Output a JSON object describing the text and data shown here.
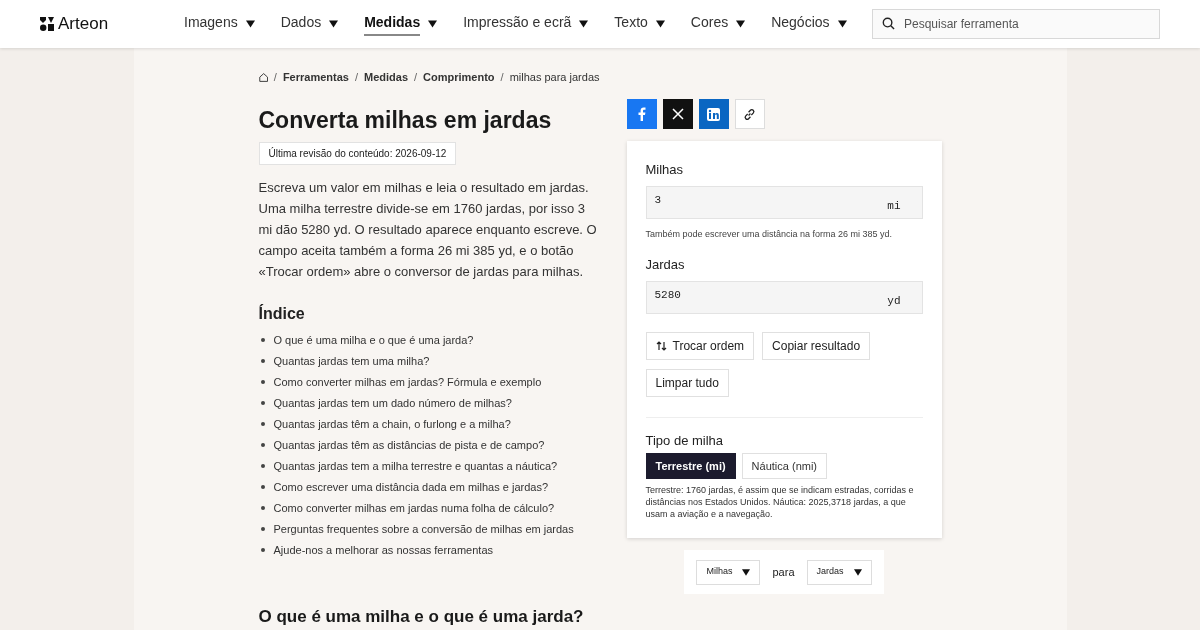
{
  "header": {
    "logo": "Arteon",
    "nav": [
      {
        "label": "Imagens",
        "selected": false
      },
      {
        "label": "Dados",
        "selected": false
      },
      {
        "label": "Medidas",
        "selected": true
      },
      {
        "label": "Impressão e ecrã",
        "selected": false
      },
      {
        "label": "Texto",
        "selected": false
      },
      {
        "label": "Cores",
        "selected": false
      },
      {
        "label": "Negócios",
        "selected": false
      }
    ],
    "search": {
      "placeholder": "Pesquisar ferramenta"
    }
  },
  "breadcrumb": [
    {
      "separator": "/",
      "label": "Ferramentas"
    },
    {
      "separator": "/",
      "label": "Medidas"
    },
    {
      "separator": "/",
      "label": "Comprimento"
    },
    {
      "separator": "/",
      "label": "milhas para jardas"
    }
  ],
  "title": "Converta milhas em jardas",
  "revision": "Última revisão do conteúdo: 2026-09-12",
  "intro": "Escreva um valor em milhas e leia o resultado em jardas. Uma milha terrestre divide-se em 1760 jardas, por isso 3 mi dão 5280 yd. O resultado aparece enquanto escreve. O campo aceita também a forma 26 mi 385 yd, e o botão «Trocar ordem» abre o conversor de jardas para milhas.",
  "toc": {
    "title": "Índice",
    "items": [
      "O que é uma milha e o que é uma jarda?",
      "Quantas jardas tem uma milha?",
      "Como converter milhas em jardas? Fórmula e exemplo",
      "Quantas jardas tem um dado número de milhas?",
      "Quantas jardas têm a chain, o furlong e a milha?",
      "Quantas jardas têm as distâncias de pista e de campo?",
      "Quantas jardas tem a milha terrestre e quantas a náutica?",
      "Como escrever uma distância dada em milhas e jardas?",
      "Como converter milhas em jardas numa folha de cálculo?",
      "Perguntas frequentes sobre a conversão de milhas em jardas",
      "Ajude-nos a melhorar as nossas ferramentas"
    ]
  },
  "section_heading": "O que é uma milha e o que é uma jarda?",
  "share": [
    {
      "kind": "facebook"
    },
    {
      "kind": "x"
    },
    {
      "kind": "linkedin"
    },
    {
      "kind": "link"
    }
  ],
  "converter": {
    "fields": [
      {
        "label": "Milhas",
        "value": "3",
        "unit": "mi",
        "hint": "Também pode escrever uma distância na forma 26 mi 385 yd."
      },
      {
        "label": "Jardas",
        "value": "5280",
        "unit": "yd"
      }
    ],
    "buttons": [
      {
        "label": "Trocar ordem",
        "kind": "swap"
      },
      {
        "label": "Copiar resultado",
        "kind": "plain"
      },
      {
        "label": "Limpar tudo",
        "kind": "plain"
      }
    ],
    "mile_type": {
      "label": "Tipo de milha",
      "options": [
        {
          "label": "Terrestre (mi)",
          "selected": true
        },
        {
          "label": "Náutica (nmi)",
          "selected": false
        }
      ],
      "note": "Terrestre: 1760 jardas, é assim que se indicam estradas, corridas e distâncias nos Estados Unidos. Náutica: 2025,3718 jardas, a que usam a aviação e a navegação."
    }
  },
  "unit_picker": {
    "from": "Milhas",
    "joiner": "para",
    "to": "Jardas"
  }
}
